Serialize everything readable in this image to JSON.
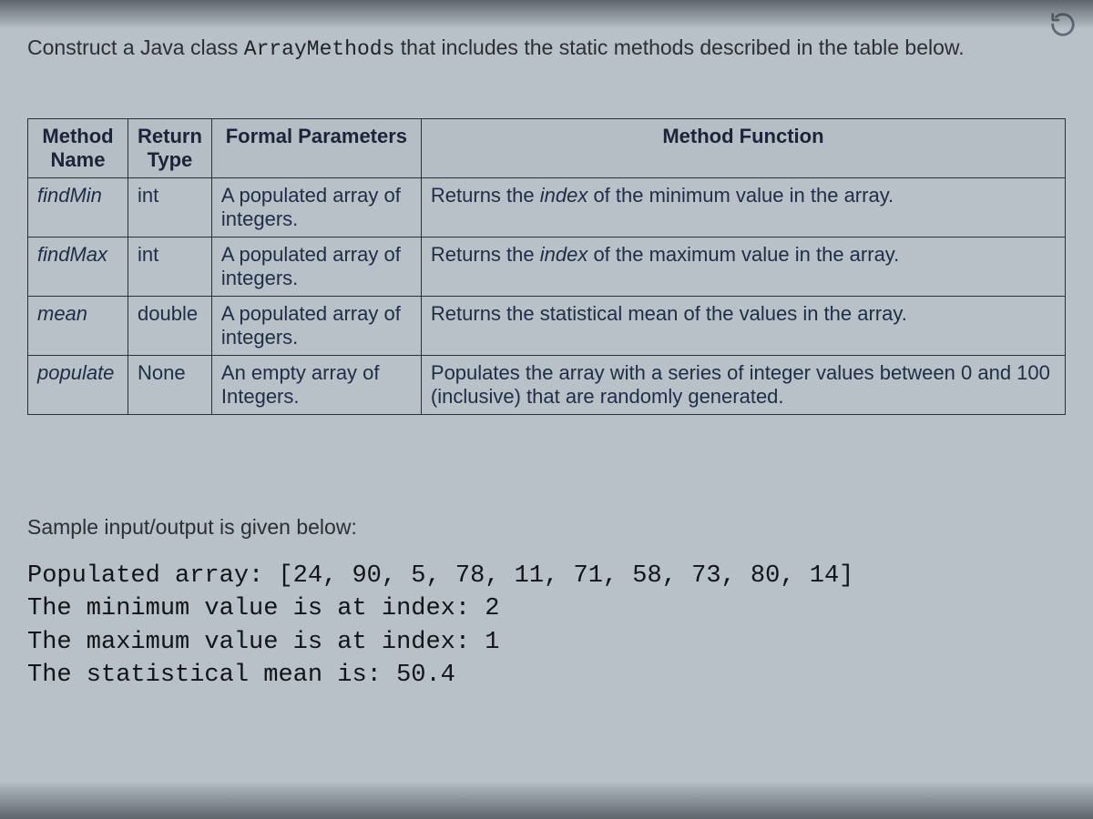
{
  "prompt": {
    "before": "Construct a Java class ",
    "classname": "ArrayMethods",
    "after": " that includes the static methods described in the table below."
  },
  "headers": {
    "method": "Method Name",
    "return": "Return Type",
    "params": "Formal Parameters",
    "function": "Method Function"
  },
  "rows": [
    {
      "name": "findMin",
      "ret": "int",
      "params": "A populated array of integers.",
      "func_pre": "Returns the ",
      "func_em": "index",
      "func_post": " of the minimum value in the array."
    },
    {
      "name": "findMax",
      "ret": "int",
      "params": "A populated array of integers.",
      "func_pre": "Returns the ",
      "func_em": "index",
      "func_post": " of the maximum value in the array."
    },
    {
      "name": "mean",
      "ret": "double",
      "params": "A populated array of integers.",
      "func_pre": "Returns the statistical mean of the values in the array.",
      "func_em": "",
      "func_post": ""
    },
    {
      "name": "populate",
      "ret": "None",
      "params": "An empty array of Integers.",
      "func_pre": "Populates the array with a series of integer values between 0 and 100 (inclusive) that are randomly generated.",
      "func_em": "",
      "func_post": ""
    }
  ],
  "sample_heading": "Sample input/output is given below:",
  "sample_output": {
    "l1": "Populated array: [24, 90, 5, 78, 11, 71, 58, 73, 80, 14]",
    "l2": "The minimum value is at index: 2",
    "l3": "The maximum value is at index: 1",
    "l4": "The statistical mean is: 50.4"
  }
}
